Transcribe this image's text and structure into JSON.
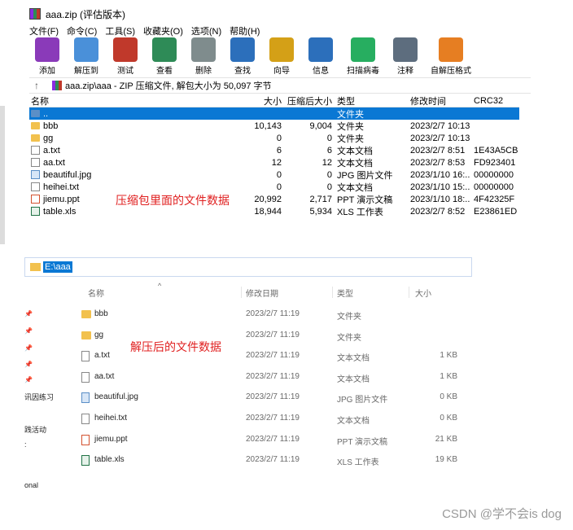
{
  "rar": {
    "title": "aaa.zip (评估版本)",
    "menu": [
      "文件(F)",
      "命令(C)",
      "工具(S)",
      "收藏夹(O)",
      "选项(N)",
      "帮助(H)"
    ],
    "toolbar": [
      {
        "label": "添加",
        "icon": "add-archive-icon",
        "color": "#8a3ab9"
      },
      {
        "label": "解压到",
        "icon": "extract-to-folder-icon",
        "color": "#4a90d9"
      },
      {
        "label": "测试",
        "icon": "test-clipboard-icon",
        "color": "#c0392b"
      },
      {
        "label": "查看",
        "icon": "view-book-icon",
        "color": "#2e8b57"
      },
      {
        "label": "删除",
        "icon": "delete-trash-icon",
        "color": "#7f8c8d"
      },
      {
        "label": "查找",
        "icon": "find-magnifier-icon",
        "color": "#2c6fbb"
      },
      {
        "label": "向导",
        "icon": "wizard-wand-icon",
        "color": "#d4a017"
      },
      {
        "label": "信息",
        "icon": "info-icon",
        "color": "#2c6fbb"
      },
      {
        "label": "扫描病毒",
        "icon": "virus-scan-icon",
        "color": "#27ae60"
      },
      {
        "label": "注释",
        "icon": "comment-icon",
        "color": "#5d6d7e"
      },
      {
        "label": "自解压格式",
        "icon": "sfx-box-icon",
        "color": "#e67e22"
      }
    ],
    "path": "aaa.zip\\aaa - ZIP 压缩文件, 解包大小为 50,097 字节",
    "columns": {
      "name": "名称",
      "size": "大小",
      "packed": "压缩后大小",
      "type": "类型",
      "modified": "修改时间",
      "crc": "CRC32"
    },
    "rows": [
      {
        "name": "..",
        "size": "",
        "packed": "",
        "type": "文件夹",
        "modified": "",
        "crc": "",
        "icon": "folder-blue",
        "selected": true
      },
      {
        "name": "bbb",
        "size": "10,143",
        "packed": "9,004",
        "type": "文件夹",
        "modified": "2023/2/7 10:13",
        "crc": "",
        "icon": "folder"
      },
      {
        "name": "gg",
        "size": "0",
        "packed": "0",
        "type": "文件夹",
        "modified": "2023/2/7 10:13",
        "crc": "",
        "icon": "folder"
      },
      {
        "name": "a.txt",
        "size": "6",
        "packed": "6",
        "type": "文本文档",
        "modified": "2023/2/7 8:51",
        "crc": "1E43A5CB",
        "icon": "txt"
      },
      {
        "name": "aa.txt",
        "size": "12",
        "packed": "12",
        "type": "文本文档",
        "modified": "2023/2/7 8:53",
        "crc": "FD923401",
        "icon": "txt"
      },
      {
        "name": "beautiful.jpg",
        "size": "0",
        "packed": "0",
        "type": "JPG 图片文件",
        "modified": "2023/1/10 16:...",
        "crc": "00000000",
        "icon": "jpg"
      },
      {
        "name": "heihei.txt",
        "size": "0",
        "packed": "0",
        "type": "文本文档",
        "modified": "2023/1/10 15:...",
        "crc": "00000000",
        "icon": "txt"
      },
      {
        "name": "jiemu.ppt",
        "size": "20,992",
        "packed": "2,717",
        "type": "PPT 演示文稿",
        "modified": "2023/1/10 18:...",
        "crc": "4F42325F",
        "icon": "ppt"
      },
      {
        "name": "table.xls",
        "size": "18,944",
        "packed": "5,934",
        "type": "XLS 工作表",
        "modified": "2023/2/7 8:52",
        "crc": "E23861ED",
        "icon": "xls"
      }
    ]
  },
  "annotations": {
    "compressed": "压缩包里面的文件数据",
    "extracted": "解压后的文件数据"
  },
  "explorer": {
    "address": "E:\\aaa",
    "columns": {
      "name": "名称",
      "modified": "修改日期",
      "type": "类型",
      "size": "大小"
    },
    "rows": [
      {
        "name": "bbb",
        "modified": "2023/2/7 11:19",
        "type": "文件夹",
        "size": "",
        "icon": "folder"
      },
      {
        "name": "gg",
        "modified": "2023/2/7 11:19",
        "type": "文件夹",
        "size": "",
        "icon": "folder"
      },
      {
        "name": "a.txt",
        "modified": "2023/2/7 11:19",
        "type": "文本文档",
        "size": "1 KB",
        "icon": "txt"
      },
      {
        "name": "aa.txt",
        "modified": "2023/2/7 11:19",
        "type": "文本文档",
        "size": "1 KB",
        "icon": "txt"
      },
      {
        "name": "beautiful.jpg",
        "modified": "2023/2/7 11:19",
        "type": "JPG 图片文件",
        "size": "0 KB",
        "icon": "jpg"
      },
      {
        "name": "heihei.txt",
        "modified": "2023/2/7 11:19",
        "type": "文本文档",
        "size": "0 KB",
        "icon": "txt"
      },
      {
        "name": "jiemu.ppt",
        "modified": "2023/2/7 11:19",
        "type": "PPT 演示文稿",
        "size": "21 KB",
        "icon": "ppt"
      },
      {
        "name": "table.xls",
        "modified": "2023/2/7 11:19",
        "type": "XLS 工作表",
        "size": "19 KB",
        "icon": "xls"
      }
    ],
    "left_fragments": [
      "讯因练习",
      "践活动",
      ":",
      "onal"
    ]
  },
  "watermark": "CSDN @学不会is dog"
}
